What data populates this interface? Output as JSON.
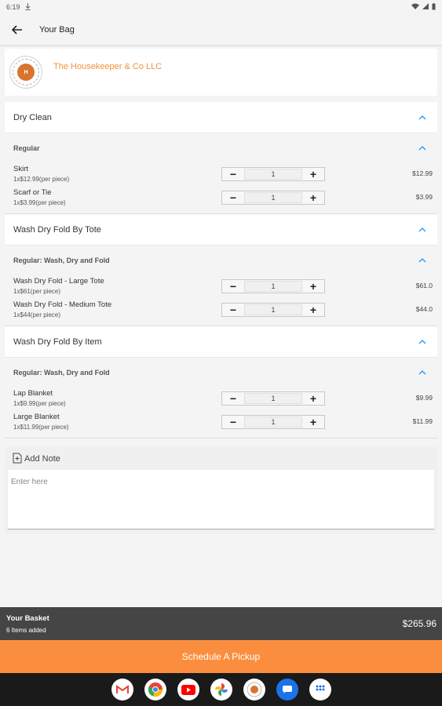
{
  "status_bar": {
    "time": "6:19"
  },
  "app_bar": {
    "title": "Your Bag"
  },
  "vendor": {
    "name": "The Housekeeper & Co LLC"
  },
  "sections": [
    {
      "title": "Dry Clean",
      "groups": [
        {
          "title": "Regular",
          "items": [
            {
              "name": "Skirt",
              "price_per": "1x$12.99(per piece)",
              "qty": "1",
              "total": "$12.99"
            },
            {
              "name": "Scarf or Tie",
              "price_per": "1x$3.99(per piece)",
              "qty": "1",
              "total": "$3.99"
            }
          ]
        }
      ]
    },
    {
      "title": "Wash Dry Fold By Tote",
      "groups": [
        {
          "title": "Regular: Wash, Dry and Fold",
          "items": [
            {
              "name": "Wash Dry Fold - Large Tote",
              "price_per": "1x$61(per piece)",
              "qty": "1",
              "total": "$61.0"
            },
            {
              "name": "Wash Dry Fold - Medium Tote",
              "price_per": "1x$44(per piece)",
              "qty": "1",
              "total": "$44.0"
            }
          ]
        }
      ]
    },
    {
      "title": "Wash Dry Fold By Item",
      "groups": [
        {
          "title": "Regular: Wash, Dry and Fold",
          "items": [
            {
              "name": "Lap Blanket",
              "price_per": "1x$9.99(per piece)",
              "qty": "1",
              "total": "$9.99"
            },
            {
              "name": "Large Blanket",
              "price_per": "1x$11.99(per piece)",
              "qty": "1",
              "total": "$11.99"
            }
          ]
        }
      ]
    }
  ],
  "note": {
    "label": "Add Note",
    "placeholder": "Enter here"
  },
  "basket": {
    "title": "Your Basket",
    "count": "6 Items added",
    "total": "$265.96"
  },
  "schedule_button": {
    "label": "Schedule A Pickup"
  },
  "dock": {
    "apps": [
      {
        "icon": "gmail-icon",
        "color": "#ea4335"
      },
      {
        "icon": "chrome-icon",
        "color": "#4285f4"
      },
      {
        "icon": "youtube-icon",
        "color": "#ff0000"
      },
      {
        "icon": "photos-icon",
        "color": "#fbbc05"
      },
      {
        "icon": "housekeeper-app-icon",
        "color": "#d8742f"
      },
      {
        "icon": "messages-icon",
        "color": "#1a73e8"
      },
      {
        "icon": "app-drawer-icon",
        "color": "#1a73e8"
      }
    ]
  },
  "colors": {
    "accent": "#fb8e3e",
    "vendor_name": "#f0913d",
    "chevron": "#2196f3",
    "basket_bar": "#454545"
  }
}
